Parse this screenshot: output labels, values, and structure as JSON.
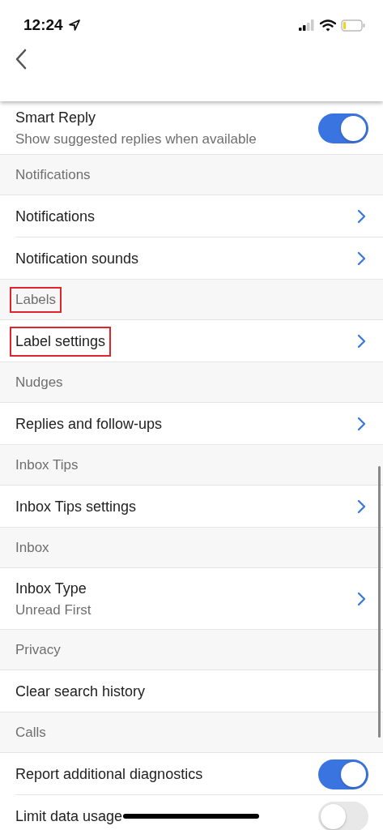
{
  "status_bar": {
    "time": "12:24"
  },
  "items": [
    {
      "kind": "toggle",
      "label": "Smart Reply",
      "subtitle": "Show suggested replies when available",
      "on": true
    },
    {
      "kind": "section",
      "label": "Notifications",
      "highlighted": false
    },
    {
      "kind": "link",
      "label": "Notifications",
      "highlighted": false
    },
    {
      "kind": "link",
      "label": "Notification sounds",
      "highlighted": false
    },
    {
      "kind": "section",
      "label": "Labels",
      "highlighted": true
    },
    {
      "kind": "link",
      "label": "Label settings",
      "highlighted": true
    },
    {
      "kind": "section",
      "label": "Nudges",
      "highlighted": false
    },
    {
      "kind": "link",
      "label": "Replies and follow-ups",
      "highlighted": false
    },
    {
      "kind": "section",
      "label": "Inbox Tips",
      "highlighted": false
    },
    {
      "kind": "link",
      "label": "Inbox Tips settings",
      "highlighted": false
    },
    {
      "kind": "section",
      "label": "Inbox",
      "highlighted": false
    },
    {
      "kind": "link",
      "label": "Inbox Type",
      "subtitle": "Unread First",
      "highlighted": false
    },
    {
      "kind": "section",
      "label": "Privacy",
      "highlighted": false
    },
    {
      "kind": "action",
      "label": "Clear search history",
      "highlighted": false
    },
    {
      "kind": "section",
      "label": "Calls",
      "highlighted": false
    },
    {
      "kind": "toggle",
      "label": "Report additional diagnostics",
      "on": true
    },
    {
      "kind": "toggle",
      "label": "Limit data usage",
      "on": false
    }
  ]
}
